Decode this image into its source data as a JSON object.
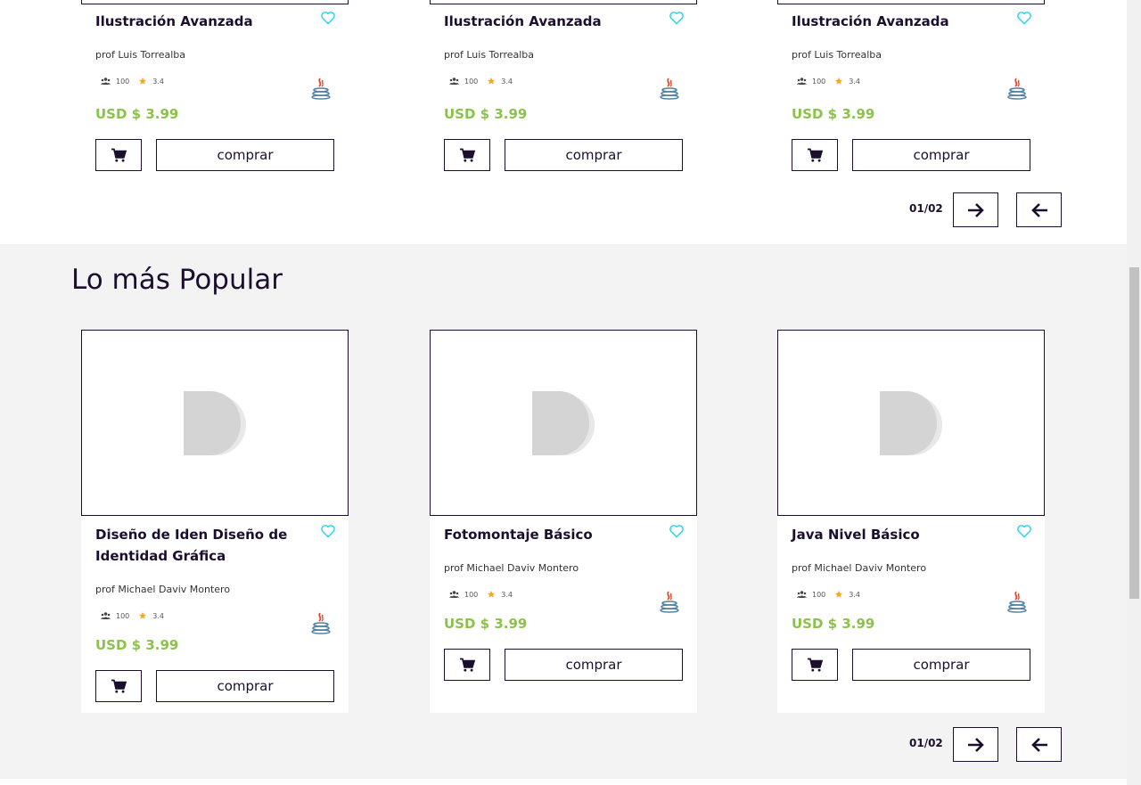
{
  "top_cards": [
    {
      "title": "Ilustración Avanzada",
      "prof": "prof Luis Torrealba",
      "students": "100",
      "rating": "3.4",
      "price": "USD $ 3.99",
      "buy": "comprar"
    },
    {
      "title": "Ilustración Avanzada",
      "prof": "prof Luis Torrealba",
      "students": "100",
      "rating": "3.4",
      "price": "USD $ 3.99",
      "buy": "comprar"
    },
    {
      "title": "Ilustración Avanzada",
      "prof": "prof Luis Torrealba",
      "students": "100",
      "rating": "3.4",
      "price": "USD $ 3.99",
      "buy": "comprar"
    }
  ],
  "top_pager": {
    "label": "01/02"
  },
  "popular": {
    "heading": "Lo más Popular",
    "cards": [
      {
        "title": "Diseño de Iden Diseño de Identidad Gráfica",
        "prof": "prof Michael Daviv Montero",
        "students": "100",
        "rating": "3.4",
        "price": "USD $ 3.99",
        "buy": "comprar"
      },
      {
        "title": "Fotomontaje Básico",
        "prof": "prof Michael Daviv Montero",
        "students": "100",
        "rating": "3.4",
        "price": "USD $ 3.99",
        "buy": "comprar"
      },
      {
        "title": "Java Nivel Básico",
        "prof": "prof Michael Daviv Montero",
        "students": "100",
        "rating": "3.4",
        "price": "USD $ 3.99",
        "buy": "comprar"
      }
    ],
    "pager": {
      "label": "01/02"
    }
  },
  "colors": {
    "brand": "#1c0f2e",
    "price": "#8bc34a",
    "heart": "#29d4e6",
    "star": "#f5a623"
  },
  "icons": {
    "favorite": "heart-icon",
    "students": "users-icon",
    "rating": "star-icon",
    "tech": "java-icon",
    "cart": "cart-icon",
    "next": "arrow-right-icon",
    "prev": "arrow-left-icon",
    "placeholder": "d-logo"
  }
}
